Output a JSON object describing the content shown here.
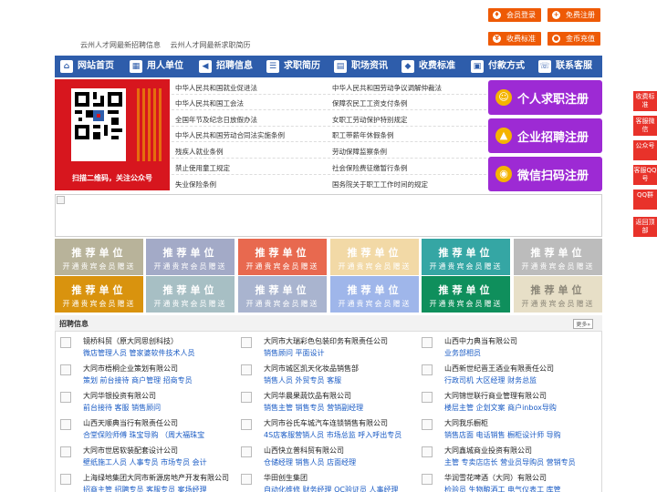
{
  "header": {
    "links": [
      "云州人才网最新招聘信息",
      "云州人才网最新求职简历"
    ],
    "buttons": [
      {
        "label": "会员登录",
        "icon": "user-icon"
      },
      {
        "label": "免费注册",
        "icon": "add-user-icon"
      },
      {
        "label": "收费标准",
        "icon": "yen-icon"
      },
      {
        "label": "金币充值",
        "icon": "coin-icon"
      }
    ]
  },
  "nav": {
    "items": [
      {
        "label": "网站首页",
        "icon": "home-icon"
      },
      {
        "label": "用人单位",
        "icon": "building-icon"
      },
      {
        "label": "招聘信息",
        "icon": "megaphone-icon"
      },
      {
        "label": "求职简历",
        "icon": "resume-icon"
      },
      {
        "label": "职场资讯",
        "icon": "news-icon"
      },
      {
        "label": "收费标准",
        "icon": "tag-icon"
      },
      {
        "label": "付款方式",
        "icon": "wallet-icon"
      },
      {
        "label": "联系客服",
        "icon": "headset-icon"
      }
    ]
  },
  "qr": {
    "caption": "扫描二维码，关注公众号"
  },
  "laws": {
    "left": [
      "中华人民共和国就业促进法",
      "中华人民共和国工会法",
      "全国年节及纪念日放假办法",
      "中华人民共和国劳动合同法实施条例",
      "残疾人就业条例",
      "禁止使用童工规定",
      "失业保险条例"
    ],
    "right": [
      "中华人民共和国劳动争议调解仲裁法",
      "保障农民工工资支付条例",
      "女职工劳动保护特别规定",
      "职工带薪年休假条例",
      "劳动保障监察条例",
      "社会保险费征缴暂行条例",
      "国务院关于职工工作时间的规定"
    ]
  },
  "register": [
    {
      "label": "个人求职注册",
      "icon": "person-icon"
    },
    {
      "label": "企业招聘注册",
      "icon": "company-icon"
    },
    {
      "label": "微信扫码注册",
      "icon": "wechat-icon"
    }
  ],
  "tiles": {
    "title": "推荐单位",
    "subtitle": "开通贵宾会员赠送"
  },
  "jobs": {
    "heading": "招聘信息",
    "more": "更多»",
    "columns": [
      [
        {
          "company": "镜桥科贸（原大同思创科技）",
          "positions": "微店管理人员 管家婆软件技术人员"
        },
        {
          "company": "大同市梧桐企业策划有限公司",
          "positions": "策划 前台接待 商户管理 招商专员"
        },
        {
          "company": "大同华银投资有限公司",
          "positions": "前台接待 客服 销售顾问"
        },
        {
          "company": "山西天顺典当行有限责任公司",
          "positions": "合堂保险师傅 珠宝导购 （周大福珠宝"
        },
        {
          "company": "大同市世居软装配套设计公司",
          "positions": "壁纸施工人员 人事专员 市场专员 会计"
        },
        {
          "company": "上海绿地集团大同市新源房地产开发有限公司",
          "positions": "招商主管 招聘专员 客服专员 案场经理"
        }
      ],
      [
        {
          "company": "大同市大瑞彩色包装印务有限责任公司",
          "positions": "销售顾问 平面设计"
        },
        {
          "company": "大同市城区凯天化妆品销售部",
          "positions": "销售人员 外贸专员 客服"
        },
        {
          "company": "大同华晨果蔬饮品有限公司",
          "positions": "销售主管 销售专员 营销副经理"
        },
        {
          "company": "大同市谷氏车城汽车连锁销售有限公司",
          "positions": "4S店客服营销人员 市场总监 呼入呼出专员"
        },
        {
          "company": "山西快立普科贸有限公司",
          "positions": "仓储经理 销售人员 店面经理"
        },
        {
          "company": "华田创生集团",
          "positions": "自动化维修 财务经理 QC验证员 人事经理"
        }
      ],
      [
        {
          "company": "山西中力典当有限公司",
          "positions": "业务部相员"
        },
        {
          "company": "山西新世纪晋王酒业有限责任公司",
          "positions": "行政司机 大区经理 财务总监"
        },
        {
          "company": "大同锦世联行商业管理有限公司",
          "positions": "楼层主管 企划文案 商户inbox导购"
        },
        {
          "company": "大同我乐橱柜",
          "positions": "销售店面 电话销售 橱柜设计师 导购"
        },
        {
          "company": "大同鑫城商业投资有限公司",
          "positions": "主管 专卖店店长 营业员导购员 营销专员"
        },
        {
          "company": "华润雪花啤酒（大同）有限公司",
          "positions": "检验员 生物酿酒工 电气仪表工 库管"
        }
      ]
    ]
  },
  "side": [
    {
      "label": "收费标准",
      "icon": "yen-icon"
    },
    {
      "label": "客服微信",
      "icon": "wechat-icon"
    },
    {
      "label": "公众号",
      "icon": "qr-icon"
    },
    {
      "label": "客服QQ号",
      "icon": "qq-icon"
    },
    {
      "label": "QQ群",
      "icon": "group-icon"
    },
    {
      "label": "返回顶部",
      "icon": "arrow-up-icon"
    }
  ],
  "colors": {
    "nav": "#2e5dab",
    "accent": "#ee5a06",
    "register": "#9d2ad4",
    "qr_bg": "#d7161e",
    "link": "#1a5bc4",
    "side": "#e8322a"
  }
}
